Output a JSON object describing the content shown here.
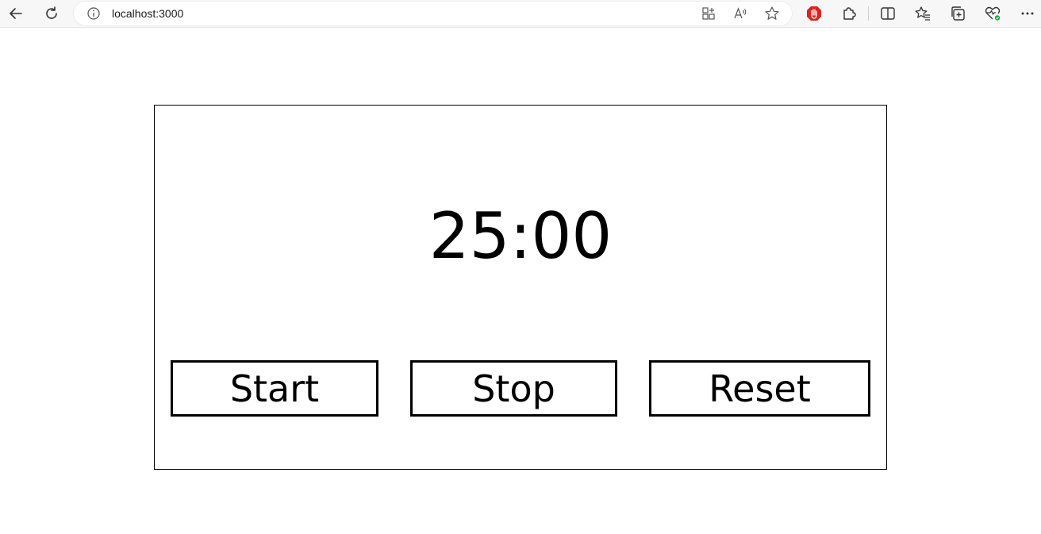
{
  "browser": {
    "url": "localhost:3000",
    "icons": {
      "back": "back-arrow-icon",
      "refresh": "refresh-icon",
      "site_info": "info-icon",
      "app_available": "app-grid-icon",
      "read_aloud": "read-aloud-icon",
      "favorite": "star-icon",
      "extension_red": "adblock-icon",
      "extensions": "puzzle-icon",
      "split_screen": "split-screen-icon",
      "favorites": "favorites-icon",
      "collections": "collections-icon",
      "browser_essentials": "heart-pulse-icon",
      "more": "more-icon"
    }
  },
  "timer": {
    "display": "25:00"
  },
  "controls": {
    "start_label": "Start",
    "stop_label": "Stop",
    "reset_label": "Reset"
  },
  "colors": {
    "border": "#000000",
    "background": "#ffffff",
    "extension_red": "#e0201b"
  }
}
